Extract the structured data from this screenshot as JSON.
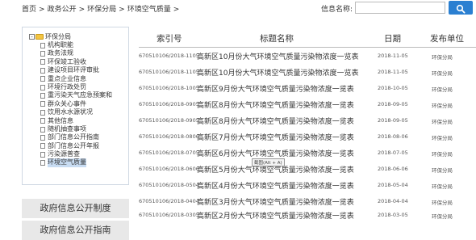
{
  "breadcrumb": {
    "items": [
      "首页",
      "政务公开",
      "环保分局",
      "环境空气质量"
    ],
    "separator": ">"
  },
  "search": {
    "label": "信息名称:",
    "value": "",
    "placeholder": "",
    "icon": "search-icon"
  },
  "sidebar": {
    "root_label": "环保分局",
    "root_toggle": "-",
    "items": [
      "机构职能",
      "政务法规",
      "环保竣工验收",
      "建设项目环评审批",
      "重点企业信息",
      "环境行政处罚",
      "重污染天气应急预案和",
      "群众关心事件",
      "饮用水水源状况",
      "其他信息",
      "随机抽查事项",
      "部门信息公开指南",
      "部门信息公开年报",
      "污染源普查",
      "环境空气质量"
    ],
    "active_index": 14
  },
  "side_buttons": [
    "政府信息公开制度",
    "政府信息公开指南"
  ],
  "table": {
    "headers": {
      "index": "索引号",
      "title": "标题名称",
      "date": "日期",
      "unit": "发布单位"
    },
    "rows": [
      {
        "index": "670510106/2018-1105",
        "title": "高新区10月份大气环境空气质量污染物浓度一览表",
        "date": "2018-11-05",
        "unit": "环保分局"
      },
      {
        "index": "670510106/2018-1105",
        "title": "高新区10月份大气环境空气质量污染物浓度一览表",
        "date": "2018-11-05",
        "unit": "环保分局"
      },
      {
        "index": "670510106/2018-1005",
        "title": "高新区9月份大气环境空气质量污染物浓度一览表",
        "date": "2018-10-05",
        "unit": "环保分局"
      },
      {
        "index": "670510106/2018-0905",
        "title": "高新区8月份大气环境空气质量污染物浓度一览表",
        "date": "2018-09-05",
        "unit": "环保分局"
      },
      {
        "index": "670510106/2018-0905",
        "title": "高新区8月份大气环境空气质量污染物浓度一览表",
        "date": "2018-09-05",
        "unit": "环保分局"
      },
      {
        "index": "670510106/2018-0806",
        "title": "高新区7月份大气环境空气质量污染物浓度一览表",
        "date": "2018-08-06",
        "unit": "环保分局"
      },
      {
        "index": "670510106/2018-0705",
        "title": "高新区6月份大气环境空气质量污染物浓度一览表",
        "date": "2018-07-05",
        "unit": "环保分局"
      },
      {
        "index": "670510106/2018-0606",
        "title": "高新区5月份大气环境空气质量污染物浓度一览表",
        "date": "2018-06-06",
        "unit": "环保分局"
      },
      {
        "index": "670510106/2018-0504",
        "title": "高新区4月份大气环境空气质量污染物浓度一览表",
        "date": "2018-05-04",
        "unit": "环保分局"
      },
      {
        "index": "670510106/2018-0404",
        "title": "高新区3月份大气环境空气质量污染物浓度一览表",
        "date": "2018-04-04",
        "unit": "环保分局"
      },
      {
        "index": "670510106/2018-0305",
        "title": "高新区2月份大气环境空气质量污染物浓度一览表",
        "date": "2018-03-05",
        "unit": "环保分局"
      }
    ]
  },
  "tooltip": "截图(Alt + A)",
  "colors": {
    "search_button": "#2a7fd1",
    "tree_border": "#cfd8e3",
    "side_button_bg": "#e8e8e8",
    "active_item": "#c8dcf2"
  }
}
